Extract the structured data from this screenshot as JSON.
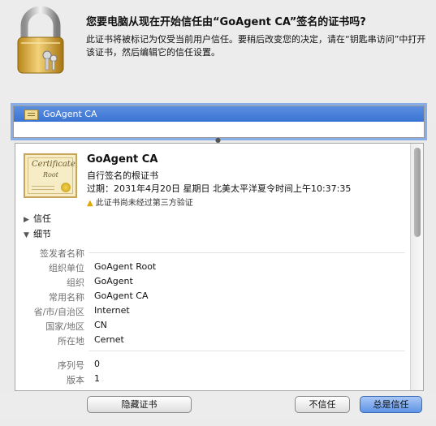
{
  "dialog": {
    "question": "您要电脑从现在开始信任由“GoAgent CA”签名的证书吗?",
    "description": "此证书将被标记为仅受当前用户信任。要稍后改变您的决定，请在“钥匙串访问”中打开该证书，然后编辑它的信任设置。"
  },
  "cert_list": {
    "selected": "GoAgent CA"
  },
  "certificate": {
    "image_words": [
      "Certificate",
      "Root"
    ],
    "name": "GoAgent CA",
    "kind": "自行签名的根证书",
    "expires": "过期：2031年4月20日 星期日 北美太平洋夏令时间上午10:37:35",
    "warning": "此证书尚未经过第三方验证"
  },
  "sections": {
    "trust": "信任",
    "details": "细节"
  },
  "fields": {
    "issuer_header": "签发者名称",
    "ou_label": "组织单位",
    "ou_value": "GoAgent Root",
    "o_label": "组织",
    "o_value": "GoAgent",
    "cn_label": "常用名称",
    "cn_value": "GoAgent CA",
    "st_label": "省/市/自治区",
    "st_value": "Internet",
    "c_label": "国家/地区",
    "c_value": "CN",
    "l_label": "所在地",
    "l_value": "Cernet",
    "serial_label": "序列号",
    "serial_value": "0",
    "version_label": "版本",
    "version_value": "1"
  },
  "buttons": {
    "hide_cert": "隐藏证书",
    "dont_trust": "不信任",
    "always_trust": "总是信任"
  },
  "colors": {
    "selection": "#3a73d3",
    "primary_button": "#5f94e6",
    "warning": "#e0a800"
  },
  "icons": {
    "lock": "padlock-with-keys-icon",
    "list_cert": "certificate-small-icon",
    "big_cert": "certificate-large-icon",
    "warning": "warning-triangle-icon"
  }
}
